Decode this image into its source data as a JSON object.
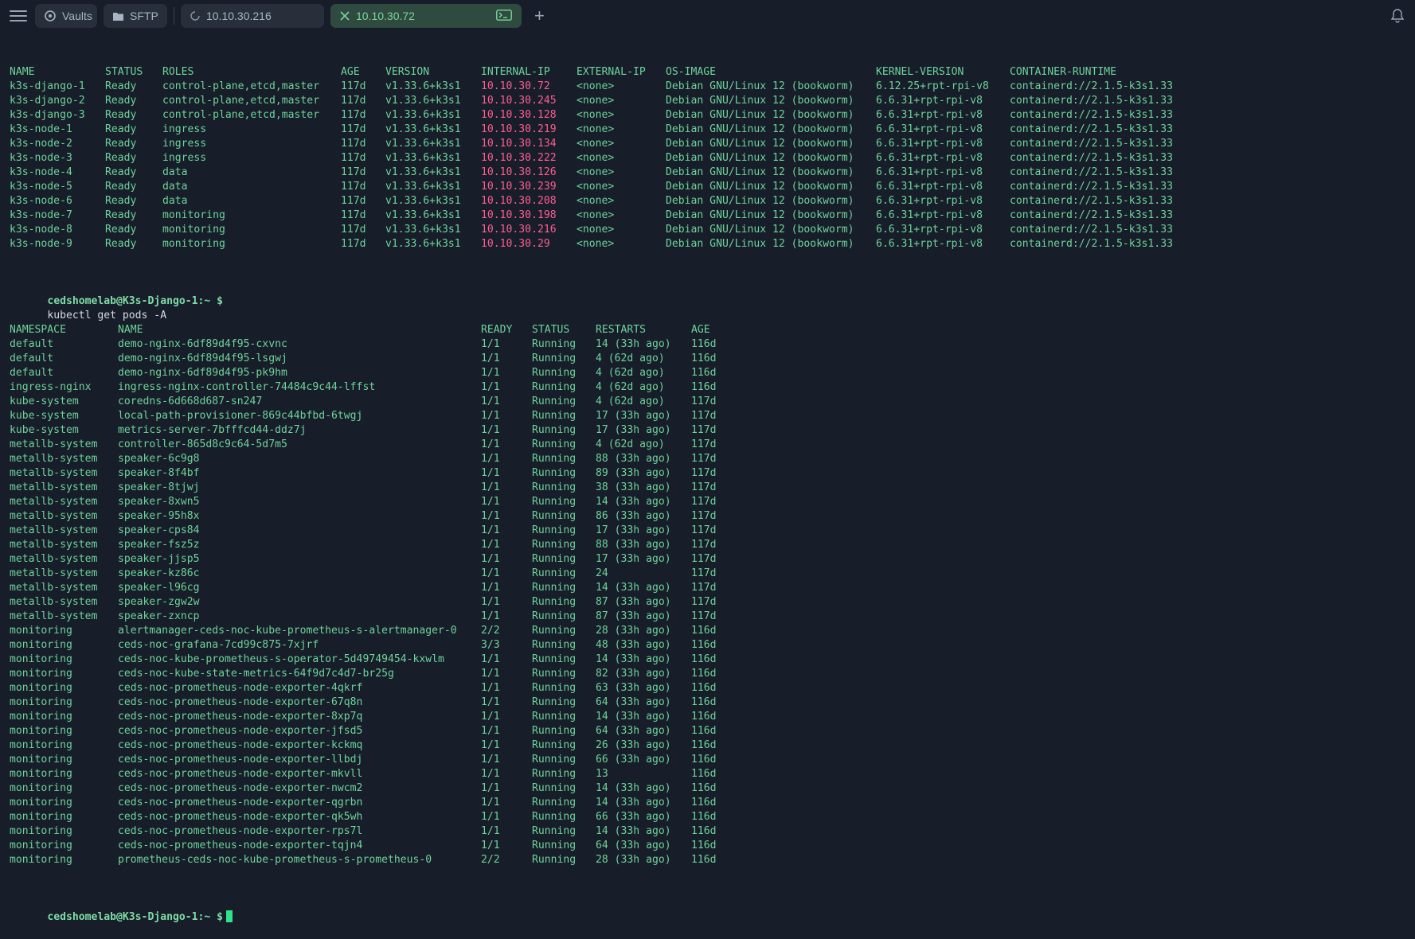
{
  "tabs": {
    "vaults": "Vaults",
    "sftp": "SFTP",
    "host1": "10.10.30.216",
    "host2": "10.10.30.72"
  },
  "nodes": {
    "headers": [
      "NAME",
      "STATUS",
      "ROLES",
      "AGE",
      "VERSION",
      "INTERNAL-IP",
      "EXTERNAL-IP",
      "OS-IMAGE",
      "KERNEL-VERSION",
      "CONTAINER-RUNTIME"
    ],
    "rows": [
      [
        "k3s-django-1",
        "Ready",
        "control-plane,etcd,master",
        "117d",
        "v1.33.6+k3s1",
        "10.10.30.72",
        "<none>",
        "Debian GNU/Linux 12 (bookworm)",
        "6.12.25+rpt-rpi-v8",
        "containerd://2.1.5-k3s1.33"
      ],
      [
        "k3s-django-2",
        "Ready",
        "control-plane,etcd,master",
        "117d",
        "v1.33.6+k3s1",
        "10.10.30.245",
        "<none>",
        "Debian GNU/Linux 12 (bookworm)",
        "6.6.31+rpt-rpi-v8",
        "containerd://2.1.5-k3s1.33"
      ],
      [
        "k3s-django-3",
        "Ready",
        "control-plane,etcd,master",
        "117d",
        "v1.33.6+k3s1",
        "10.10.30.128",
        "<none>",
        "Debian GNU/Linux 12 (bookworm)",
        "6.6.31+rpt-rpi-v8",
        "containerd://2.1.5-k3s1.33"
      ],
      [
        "k3s-node-1",
        "Ready",
        "ingress",
        "117d",
        "v1.33.6+k3s1",
        "10.10.30.219",
        "<none>",
        "Debian GNU/Linux 12 (bookworm)",
        "6.6.31+rpt-rpi-v8",
        "containerd://2.1.5-k3s1.33"
      ],
      [
        "k3s-node-2",
        "Ready",
        "ingress",
        "117d",
        "v1.33.6+k3s1",
        "10.10.30.134",
        "<none>",
        "Debian GNU/Linux 12 (bookworm)",
        "6.6.31+rpt-rpi-v8",
        "containerd://2.1.5-k3s1.33"
      ],
      [
        "k3s-node-3",
        "Ready",
        "ingress",
        "117d",
        "v1.33.6+k3s1",
        "10.10.30.222",
        "<none>",
        "Debian GNU/Linux 12 (bookworm)",
        "6.6.31+rpt-rpi-v8",
        "containerd://2.1.5-k3s1.33"
      ],
      [
        "k3s-node-4",
        "Ready",
        "data",
        "117d",
        "v1.33.6+k3s1",
        "10.10.30.126",
        "<none>",
        "Debian GNU/Linux 12 (bookworm)",
        "6.6.31+rpt-rpi-v8",
        "containerd://2.1.5-k3s1.33"
      ],
      [
        "k3s-node-5",
        "Ready",
        "data",
        "117d",
        "v1.33.6+k3s1",
        "10.10.30.239",
        "<none>",
        "Debian GNU/Linux 12 (bookworm)",
        "6.6.31+rpt-rpi-v8",
        "containerd://2.1.5-k3s1.33"
      ],
      [
        "k3s-node-6",
        "Ready",
        "data",
        "117d",
        "v1.33.6+k3s1",
        "10.10.30.208",
        "<none>",
        "Debian GNU/Linux 12 (bookworm)",
        "6.6.31+rpt-rpi-v8",
        "containerd://2.1.5-k3s1.33"
      ],
      [
        "k3s-node-7",
        "Ready",
        "monitoring",
        "117d",
        "v1.33.6+k3s1",
        "10.10.30.198",
        "<none>",
        "Debian GNU/Linux 12 (bookworm)",
        "6.6.31+rpt-rpi-v8",
        "containerd://2.1.5-k3s1.33"
      ],
      [
        "k3s-node-8",
        "Ready",
        "monitoring",
        "117d",
        "v1.33.6+k3s1",
        "10.10.30.216",
        "<none>",
        "Debian GNU/Linux 12 (bookworm)",
        "6.6.31+rpt-rpi-v8",
        "containerd://2.1.5-k3s1.33"
      ],
      [
        "k3s-node-9",
        "Ready",
        "monitoring",
        "117d",
        "v1.33.6+k3s1",
        "10.10.30.29",
        "<none>",
        "Debian GNU/Linux 12 (bookworm)",
        "6.6.31+rpt-rpi-v8",
        "containerd://2.1.5-k3s1.33"
      ]
    ]
  },
  "prompt": {
    "user": "cedshomelab@K3s-Django-1:~ $",
    "command": "kubectl get pods -A"
  },
  "pods": {
    "headers": [
      "NAMESPACE",
      "NAME",
      "READY",
      "STATUS",
      "RESTARTS",
      "AGE"
    ],
    "rows": [
      [
        "default",
        "demo-nginx-6df89d4f95-cxvnc",
        "1/1",
        "Running",
        "14 (33h ago)",
        "116d"
      ],
      [
        "default",
        "demo-nginx-6df89d4f95-lsgwj",
        "1/1",
        "Running",
        "4 (62d ago)",
        "116d"
      ],
      [
        "default",
        "demo-nginx-6df89d4f95-pk9hm",
        "1/1",
        "Running",
        "4 (62d ago)",
        "116d"
      ],
      [
        "ingress-nginx",
        "ingress-nginx-controller-74484c9c44-lffst",
        "1/1",
        "Running",
        "4 (62d ago)",
        "116d"
      ],
      [
        "kube-system",
        "coredns-6d668d687-sn247",
        "1/1",
        "Running",
        "4 (62d ago)",
        "117d"
      ],
      [
        "kube-system",
        "local-path-provisioner-869c44bfbd-6twgj",
        "1/1",
        "Running",
        "17 (33h ago)",
        "117d"
      ],
      [
        "kube-system",
        "metrics-server-7bfffcd44-ddz7j",
        "1/1",
        "Running",
        "17 (33h ago)",
        "117d"
      ],
      [
        "metallb-system",
        "controller-865d8c9c64-5d7m5",
        "1/1",
        "Running",
        "4 (62d ago)",
        "117d"
      ],
      [
        "metallb-system",
        "speaker-6c9g8",
        "1/1",
        "Running",
        "88 (33h ago)",
        "117d"
      ],
      [
        "metallb-system",
        "speaker-8f4bf",
        "1/1",
        "Running",
        "89 (33h ago)",
        "117d"
      ],
      [
        "metallb-system",
        "speaker-8tjwj",
        "1/1",
        "Running",
        "38 (33h ago)",
        "117d"
      ],
      [
        "metallb-system",
        "speaker-8xwn5",
        "1/1",
        "Running",
        "14 (33h ago)",
        "117d"
      ],
      [
        "metallb-system",
        "speaker-95h8x",
        "1/1",
        "Running",
        "86 (33h ago)",
        "117d"
      ],
      [
        "metallb-system",
        "speaker-cps84",
        "1/1",
        "Running",
        "17 (33h ago)",
        "117d"
      ],
      [
        "metallb-system",
        "speaker-fsz5z",
        "1/1",
        "Running",
        "88 (33h ago)",
        "117d"
      ],
      [
        "metallb-system",
        "speaker-jjsp5",
        "1/1",
        "Running",
        "17 (33h ago)",
        "117d"
      ],
      [
        "metallb-system",
        "speaker-kz86c",
        "1/1",
        "Running",
        "24",
        "117d"
      ],
      [
        "metallb-system",
        "speaker-l96cg",
        "1/1",
        "Running",
        "14 (33h ago)",
        "117d"
      ],
      [
        "metallb-system",
        "speaker-zgw2w",
        "1/1",
        "Running",
        "87 (33h ago)",
        "117d"
      ],
      [
        "metallb-system",
        "speaker-zxncp",
        "1/1",
        "Running",
        "87 (33h ago)",
        "117d"
      ],
      [
        "monitoring",
        "alertmanager-ceds-noc-kube-prometheus-s-alertmanager-0",
        "2/2",
        "Running",
        "28 (33h ago)",
        "116d"
      ],
      [
        "monitoring",
        "ceds-noc-grafana-7cd99c875-7xjrf",
        "3/3",
        "Running",
        "48 (33h ago)",
        "116d"
      ],
      [
        "monitoring",
        "ceds-noc-kube-prometheus-s-operator-5d49749454-kxwlm",
        "1/1",
        "Running",
        "14 (33h ago)",
        "116d"
      ],
      [
        "monitoring",
        "ceds-noc-kube-state-metrics-64f9d7c4d7-br25g",
        "1/1",
        "Running",
        "82 (33h ago)",
        "116d"
      ],
      [
        "monitoring",
        "ceds-noc-prometheus-node-exporter-4qkrf",
        "1/1",
        "Running",
        "63 (33h ago)",
        "116d"
      ],
      [
        "monitoring",
        "ceds-noc-prometheus-node-exporter-67q8n",
        "1/1",
        "Running",
        "64 (33h ago)",
        "116d"
      ],
      [
        "monitoring",
        "ceds-noc-prometheus-node-exporter-8xp7q",
        "1/1",
        "Running",
        "14 (33h ago)",
        "116d"
      ],
      [
        "monitoring",
        "ceds-noc-prometheus-node-exporter-jfsd5",
        "1/1",
        "Running",
        "64 (33h ago)",
        "116d"
      ],
      [
        "monitoring",
        "ceds-noc-prometheus-node-exporter-kckmq",
        "1/1",
        "Running",
        "26 (33h ago)",
        "116d"
      ],
      [
        "monitoring",
        "ceds-noc-prometheus-node-exporter-llbdj",
        "1/1",
        "Running",
        "66 (33h ago)",
        "116d"
      ],
      [
        "monitoring",
        "ceds-noc-prometheus-node-exporter-mkvll",
        "1/1",
        "Running",
        "13",
        "116d"
      ],
      [
        "monitoring",
        "ceds-noc-prometheus-node-exporter-nwcm2",
        "1/1",
        "Running",
        "14 (33h ago)",
        "116d"
      ],
      [
        "monitoring",
        "ceds-noc-prometheus-node-exporter-qgrbn",
        "1/1",
        "Running",
        "14 (33h ago)",
        "116d"
      ],
      [
        "monitoring",
        "ceds-noc-prometheus-node-exporter-qk5wh",
        "1/1",
        "Running",
        "66 (33h ago)",
        "116d"
      ],
      [
        "monitoring",
        "ceds-noc-prometheus-node-exporter-rps7l",
        "1/1",
        "Running",
        "14 (33h ago)",
        "116d"
      ],
      [
        "monitoring",
        "ceds-noc-prometheus-node-exporter-tqjn4",
        "1/1",
        "Running",
        "64 (33h ago)",
        "116d"
      ],
      [
        "monitoring",
        "prometheus-ceds-noc-kube-prometheus-s-prometheus-0",
        "2/2",
        "Running",
        "28 (33h ago)",
        "116d"
      ]
    ]
  },
  "colors": {
    "background": "#171e2a",
    "text": "#6fd39a",
    "ip": "#ff5d8f",
    "active_tab": "#2f4a3f"
  },
  "icons": [
    "menu-icon",
    "vaults-icon",
    "folder-icon",
    "loading-icon",
    "close-icon",
    "terminal-icon",
    "plus-icon",
    "bell-icon"
  ]
}
